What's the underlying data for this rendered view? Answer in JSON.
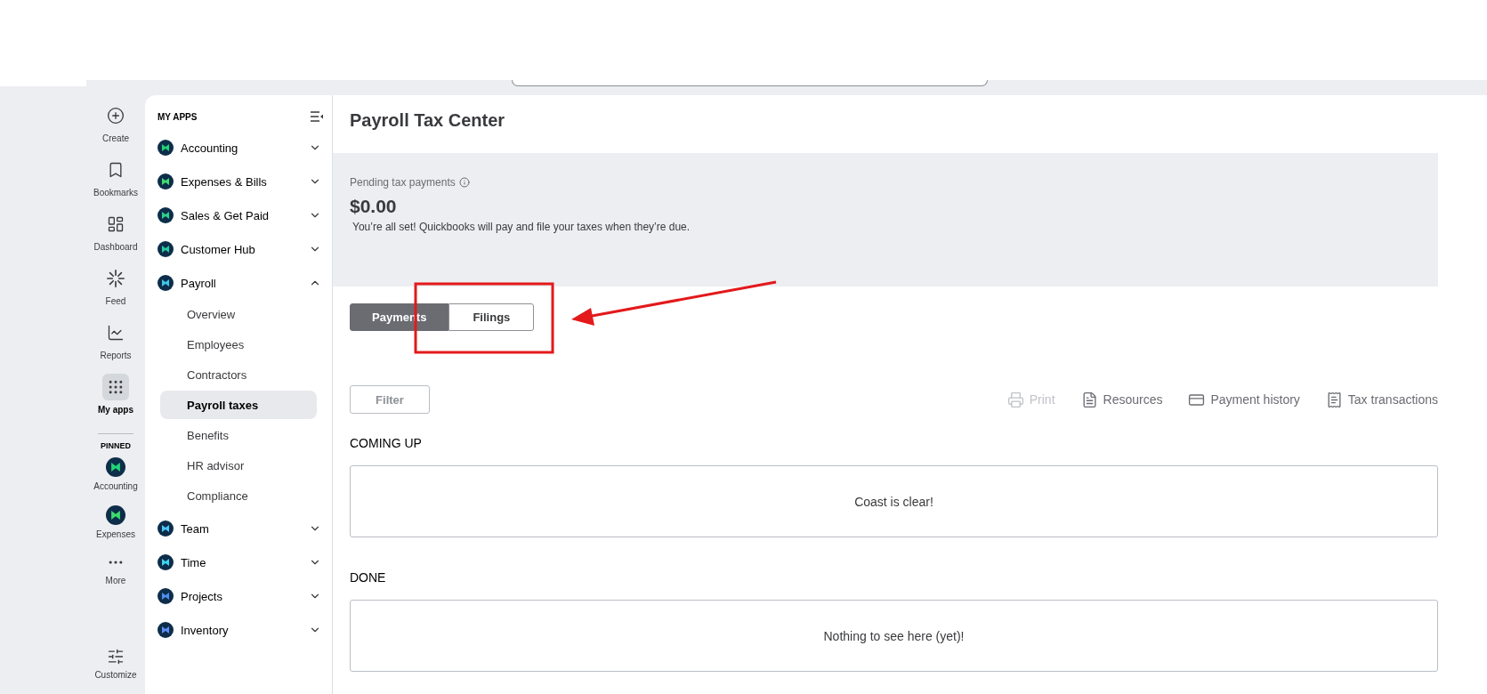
{
  "rail": {
    "items": [
      {
        "label": "Create",
        "selected": false
      },
      {
        "label": "Bookmarks",
        "selected": false
      },
      {
        "label": "Dashboard",
        "selected": false
      },
      {
        "label": "Feed",
        "selected": false
      },
      {
        "label": "Reports",
        "selected": false
      },
      {
        "label": "My apps",
        "selected": true
      }
    ],
    "pinned_heading": "PINNED",
    "pinned": [
      {
        "label": "Accounting"
      },
      {
        "label": "Expenses"
      }
    ],
    "more": {
      "label": "More"
    },
    "customize": {
      "label": "Customize"
    }
  },
  "sidebar": {
    "heading": "MY APPS",
    "apps": [
      {
        "label": "Accounting",
        "expanded": false
      },
      {
        "label": "Expenses & Bills",
        "expanded": false
      },
      {
        "label": "Sales & Get Paid",
        "expanded": false
      },
      {
        "label": "Customer Hub",
        "expanded": false
      },
      {
        "label": "Payroll",
        "expanded": true,
        "children": [
          {
            "label": "Overview",
            "selected": false
          },
          {
            "label": "Employees",
            "selected": false
          },
          {
            "label": "Contractors",
            "selected": false
          },
          {
            "label": "Payroll taxes",
            "selected": true
          },
          {
            "label": "Benefits",
            "selected": false
          },
          {
            "label": "HR advisor",
            "selected": false
          },
          {
            "label": "Compliance",
            "selected": false
          }
        ]
      },
      {
        "label": "Team",
        "expanded": false
      },
      {
        "label": "Time",
        "expanded": false
      },
      {
        "label": "Projects",
        "expanded": false
      },
      {
        "label": "Inventory",
        "expanded": false
      }
    ]
  },
  "main": {
    "title": "Payroll Tax Center",
    "summary": {
      "label": "Pending tax payments",
      "amount": "$0.00",
      "note": "You’re all set! Quickbooks will pay and file your taxes when they’re due."
    },
    "tabs": [
      {
        "label": "Payments",
        "selected": true
      },
      {
        "label": "Filings",
        "selected": false
      }
    ],
    "filter": {
      "label": "Filter",
      "disabled": true
    },
    "actions": [
      {
        "label": "Print",
        "disabled": true
      },
      {
        "label": "Resources",
        "disabled": false
      },
      {
        "label": "Payment history",
        "disabled": false
      },
      {
        "label": "Tax transactions",
        "disabled": false
      }
    ],
    "sections": [
      {
        "heading": "COMING UP",
        "message": "Coast is clear!"
      },
      {
        "heading": "DONE",
        "message": "Nothing to see here (yet)!"
      }
    ]
  }
}
